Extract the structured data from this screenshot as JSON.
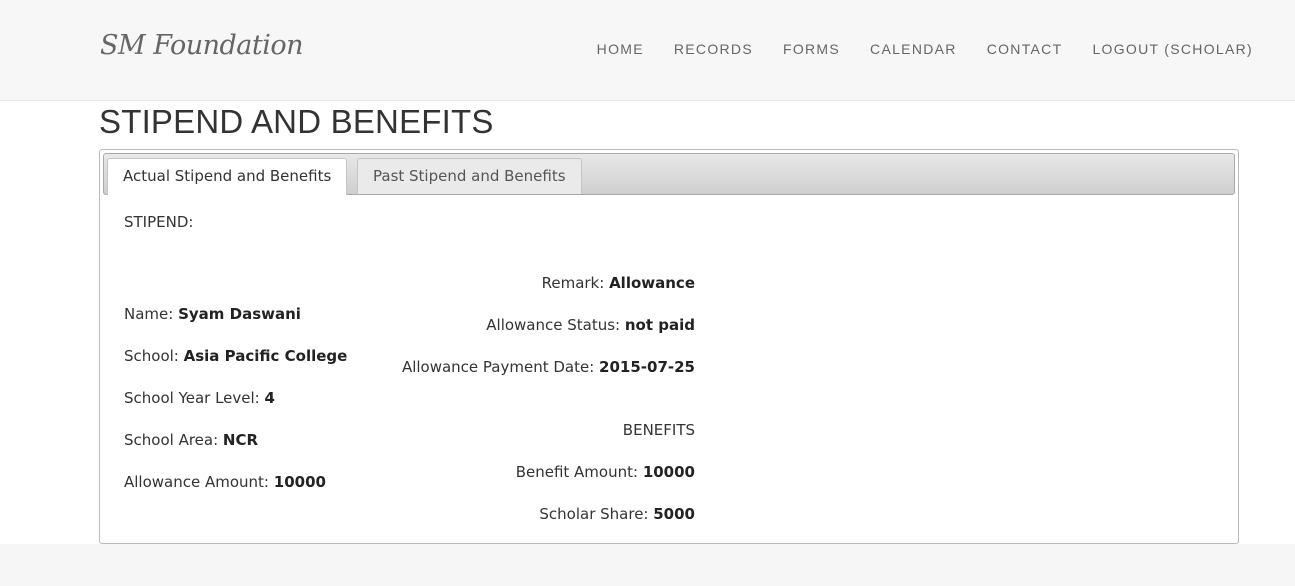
{
  "brand": "SM Foundation",
  "nav": [
    "HOME",
    "RECORDS",
    "FORMS",
    "CALENDAR",
    "CONTACT",
    "LOGOUT (SCHOLAR)"
  ],
  "page_title": "STIPEND AND BENEFITS",
  "tabs": {
    "active": "Actual Stipend and Benefits",
    "inactive": "Past Stipend and Benefits"
  },
  "section_title": "STIPEND:",
  "left_fields": [
    {
      "label": "Name: ",
      "value": "Syam Daswani"
    },
    {
      "label": "School: ",
      "value": "Asia Pacific College"
    },
    {
      "label": "School Year Level: ",
      "value": "4"
    },
    {
      "label": "School Area: ",
      "value": "NCR"
    },
    {
      "label": "Allowance Amount: ",
      "value": "10000"
    }
  ],
  "right_fields": [
    {
      "label": "Remark: ",
      "value": "Allowance"
    },
    {
      "label": "Allowance Status: ",
      "value": "not paid"
    },
    {
      "label": "Allowance Payment Date: ",
      "value": "2015-07-25"
    }
  ],
  "benefits_heading": "BENEFITS",
  "benefit_fields": [
    {
      "label": "Benefit Amount: ",
      "value": "10000"
    },
    {
      "label": "Scholar Share: ",
      "value": "5000"
    }
  ]
}
